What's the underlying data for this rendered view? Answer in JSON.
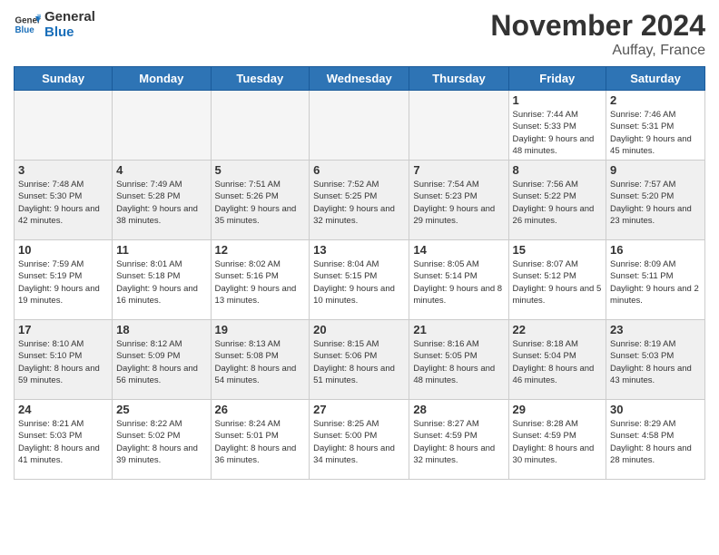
{
  "header": {
    "logo_line1": "General",
    "logo_line2": "Blue",
    "month_title": "November 2024",
    "location": "Auffay, France"
  },
  "columns": [
    "Sunday",
    "Monday",
    "Tuesday",
    "Wednesday",
    "Thursday",
    "Friday",
    "Saturday"
  ],
  "weeks": [
    [
      {
        "day": "",
        "info": ""
      },
      {
        "day": "",
        "info": ""
      },
      {
        "day": "",
        "info": ""
      },
      {
        "day": "",
        "info": ""
      },
      {
        "day": "",
        "info": ""
      },
      {
        "day": "1",
        "info": "Sunrise: 7:44 AM\nSunset: 5:33 PM\nDaylight: 9 hours and 48 minutes."
      },
      {
        "day": "2",
        "info": "Sunrise: 7:46 AM\nSunset: 5:31 PM\nDaylight: 9 hours and 45 minutes."
      }
    ],
    [
      {
        "day": "3",
        "info": "Sunrise: 7:48 AM\nSunset: 5:30 PM\nDaylight: 9 hours and 42 minutes."
      },
      {
        "day": "4",
        "info": "Sunrise: 7:49 AM\nSunset: 5:28 PM\nDaylight: 9 hours and 38 minutes."
      },
      {
        "day": "5",
        "info": "Sunrise: 7:51 AM\nSunset: 5:26 PM\nDaylight: 9 hours and 35 minutes."
      },
      {
        "day": "6",
        "info": "Sunrise: 7:52 AM\nSunset: 5:25 PM\nDaylight: 9 hours and 32 minutes."
      },
      {
        "day": "7",
        "info": "Sunrise: 7:54 AM\nSunset: 5:23 PM\nDaylight: 9 hours and 29 minutes."
      },
      {
        "day": "8",
        "info": "Sunrise: 7:56 AM\nSunset: 5:22 PM\nDaylight: 9 hours and 26 minutes."
      },
      {
        "day": "9",
        "info": "Sunrise: 7:57 AM\nSunset: 5:20 PM\nDaylight: 9 hours and 23 minutes."
      }
    ],
    [
      {
        "day": "10",
        "info": "Sunrise: 7:59 AM\nSunset: 5:19 PM\nDaylight: 9 hours and 19 minutes."
      },
      {
        "day": "11",
        "info": "Sunrise: 8:01 AM\nSunset: 5:18 PM\nDaylight: 9 hours and 16 minutes."
      },
      {
        "day": "12",
        "info": "Sunrise: 8:02 AM\nSunset: 5:16 PM\nDaylight: 9 hours and 13 minutes."
      },
      {
        "day": "13",
        "info": "Sunrise: 8:04 AM\nSunset: 5:15 PM\nDaylight: 9 hours and 10 minutes."
      },
      {
        "day": "14",
        "info": "Sunrise: 8:05 AM\nSunset: 5:14 PM\nDaylight: 9 hours and 8 minutes."
      },
      {
        "day": "15",
        "info": "Sunrise: 8:07 AM\nSunset: 5:12 PM\nDaylight: 9 hours and 5 minutes."
      },
      {
        "day": "16",
        "info": "Sunrise: 8:09 AM\nSunset: 5:11 PM\nDaylight: 9 hours and 2 minutes."
      }
    ],
    [
      {
        "day": "17",
        "info": "Sunrise: 8:10 AM\nSunset: 5:10 PM\nDaylight: 8 hours and 59 minutes."
      },
      {
        "day": "18",
        "info": "Sunrise: 8:12 AM\nSunset: 5:09 PM\nDaylight: 8 hours and 56 minutes."
      },
      {
        "day": "19",
        "info": "Sunrise: 8:13 AM\nSunset: 5:08 PM\nDaylight: 8 hours and 54 minutes."
      },
      {
        "day": "20",
        "info": "Sunrise: 8:15 AM\nSunset: 5:06 PM\nDaylight: 8 hours and 51 minutes."
      },
      {
        "day": "21",
        "info": "Sunrise: 8:16 AM\nSunset: 5:05 PM\nDaylight: 8 hours and 48 minutes."
      },
      {
        "day": "22",
        "info": "Sunrise: 8:18 AM\nSunset: 5:04 PM\nDaylight: 8 hours and 46 minutes."
      },
      {
        "day": "23",
        "info": "Sunrise: 8:19 AM\nSunset: 5:03 PM\nDaylight: 8 hours and 43 minutes."
      }
    ],
    [
      {
        "day": "24",
        "info": "Sunrise: 8:21 AM\nSunset: 5:03 PM\nDaylight: 8 hours and 41 minutes."
      },
      {
        "day": "25",
        "info": "Sunrise: 8:22 AM\nSunset: 5:02 PM\nDaylight: 8 hours and 39 minutes."
      },
      {
        "day": "26",
        "info": "Sunrise: 8:24 AM\nSunset: 5:01 PM\nDaylight: 8 hours and 36 minutes."
      },
      {
        "day": "27",
        "info": "Sunrise: 8:25 AM\nSunset: 5:00 PM\nDaylight: 8 hours and 34 minutes."
      },
      {
        "day": "28",
        "info": "Sunrise: 8:27 AM\nSunset: 4:59 PM\nDaylight: 8 hours and 32 minutes."
      },
      {
        "day": "29",
        "info": "Sunrise: 8:28 AM\nSunset: 4:59 PM\nDaylight: 8 hours and 30 minutes."
      },
      {
        "day": "30",
        "info": "Sunrise: 8:29 AM\nSunset: 4:58 PM\nDaylight: 8 hours and 28 minutes."
      }
    ]
  ]
}
